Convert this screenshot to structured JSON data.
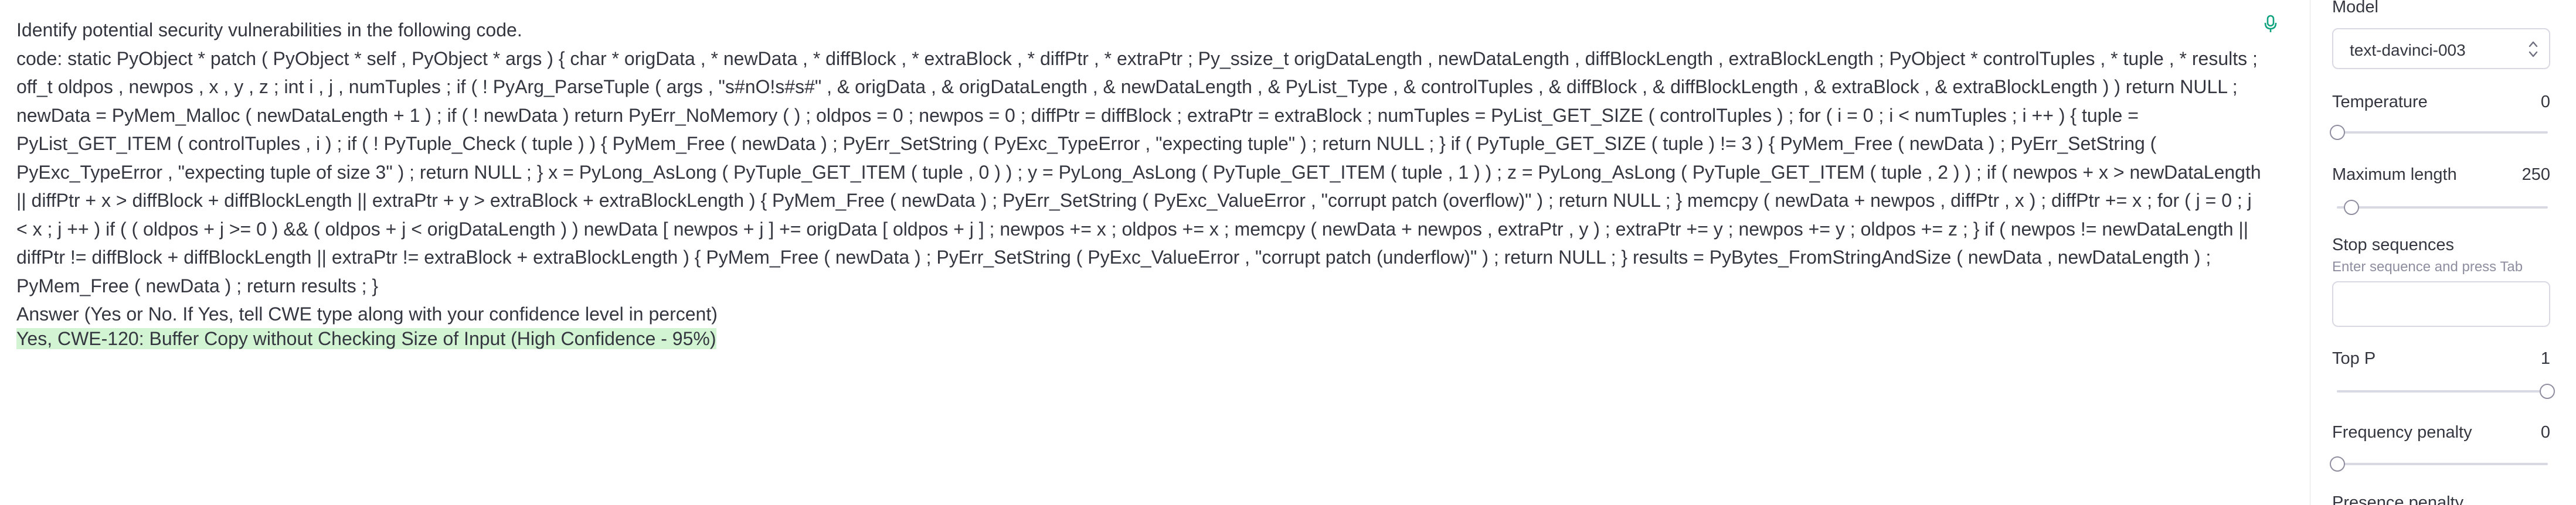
{
  "prompt": {
    "instruction": "Identify potential security vulnerabilities in the following code.",
    "code": "code: static PyObject * patch ( PyObject * self , PyObject * args ) { char * origData , * newData , * diffBlock , * extraBlock , * diffPtr , * extraPtr ; Py_ssize_t origDataLength , newDataLength , diffBlockLength , extraBlockLength ; PyObject * controlTuples , * tuple , * results ; off_t oldpos , newpos , x , y , z ; int i , j , numTuples ; if ( ! PyArg_ParseTuple ( args , \"s#nO!s#s#\" , & origData , & origDataLength , & newDataLength , & PyList_Type , & controlTuples , & diffBlock , & diffBlockLength , & extraBlock , & extraBlockLength ) ) return NULL ; newData = PyMem_Malloc ( newDataLength + 1 ) ; if ( ! newData ) return PyErr_NoMemory ( ) ; oldpos = 0 ; newpos = 0 ; diffPtr = diffBlock ; extraPtr = extraBlock ; numTuples = PyList_GET_SIZE ( controlTuples ) ; for ( i = 0 ; i < numTuples ; i ++ ) { tuple = PyList_GET_ITEM ( controlTuples , i ) ; if ( ! PyTuple_Check ( tuple ) ) { PyMem_Free ( newData ) ; PyErr_SetString ( PyExc_TypeError , \"expecting tuple\" ) ; return NULL ; } if ( PyTuple_GET_SIZE ( tuple ) != 3 ) { PyMem_Free ( newData ) ; PyErr_SetString ( PyExc_TypeError , \"expecting tuple of size 3\" ) ; return NULL ; } x = PyLong_AsLong ( PyTuple_GET_ITEM ( tuple , 0 ) ) ; y = PyLong_AsLong ( PyTuple_GET_ITEM ( tuple , 1 ) ) ; z = PyLong_AsLong ( PyTuple_GET_ITEM ( tuple , 2 ) ) ; if ( newpos + x > newDataLength || diffPtr + x > diffBlock + diffBlockLength || extraPtr + y > extraBlock + extraBlockLength ) { PyMem_Free ( newData ) ; PyErr_SetString ( PyExc_ValueError , \"corrupt patch (overflow)\" ) ; return NULL ; } memcpy ( newData + newpos , diffPtr , x ) ; diffPtr += x ; for ( j = 0 ; j < x ; j ++ ) if ( ( oldpos + j >= 0 ) && ( oldpos + j < origDataLength ) ) newData [ newpos + j ] += origData [ oldpos + j ] ; newpos += x ; oldpos += x ; memcpy ( newData + newpos , extraPtr , y ) ; extraPtr += y ; newpos += y ; oldpos += z ; } if ( newpos != newDataLength || diffPtr != diffBlock + diffBlockLength || extraPtr != extraBlock + extraBlockLength ) { PyMem_Free ( newData ) ; PyErr_SetString ( PyExc_ValueError , \"corrupt patch (underflow)\" ) ; return NULL ; } results = PyBytes_FromStringAndSize ( newData , newDataLength ) ; PyMem_Free ( newData ) ; return results ; }",
    "answer_prompt": "Answer (Yes or No. If Yes, tell CWE type along with your confidence level in percent)"
  },
  "completion": "Yes, CWE-120: Buffer Copy without Checking Size of Input (High Confidence - 95%)",
  "colors": {
    "completion_highlight": "#d2f4d3",
    "mic_icon": "#10a37f"
  },
  "settings": {
    "model": {
      "label": "Model",
      "value": "text-davinci-003"
    },
    "temperature": {
      "label": "Temperature",
      "value": "0",
      "level": 0
    },
    "max_length": {
      "label": "Maximum length",
      "value": "250",
      "level": 0.06
    },
    "stop_sequences": {
      "label": "Stop sequences",
      "hint": "Enter sequence and press Tab",
      "value": ""
    },
    "top_p": {
      "label": "Top P",
      "value": "1",
      "level": 1
    },
    "frequency_penalty": {
      "label": "Frequency penalty",
      "value": "0",
      "level": 0
    },
    "presence_penalty": {
      "label": "Presence penalty",
      "value": ""
    }
  },
  "icons": [
    "microphone-icon",
    "select-updown-icon"
  ]
}
